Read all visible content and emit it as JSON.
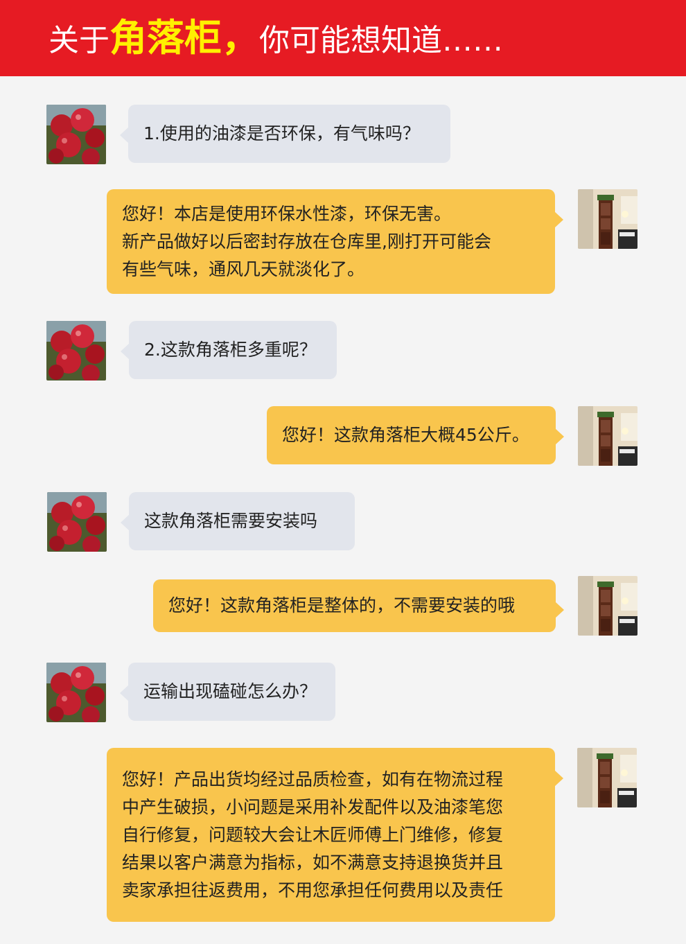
{
  "header": {
    "title_prefix": "关于",
    "title_highlight": "角落柜，",
    "title_suffix": "你可能想知道……"
  },
  "avatars": {
    "customer": "apple-photo",
    "seller": "corner-cabinet-photo"
  },
  "messages": [
    {
      "role": "customer",
      "lines": [
        "1.使用的油漆是否环保，有气味吗？"
      ]
    },
    {
      "role": "seller",
      "lines": [
        "您好！本店是使用环保水性漆，环保无害。",
        "新产品做好以后密封存放在仓库里,刚打开可能会",
        "有些气味，通风几天就淡化了。"
      ]
    },
    {
      "role": "customer",
      "lines": [
        "2.这款角落柜多重呢？"
      ]
    },
    {
      "role": "seller",
      "lines": [
        "您好！这款角落柜大概45公斤。"
      ]
    },
    {
      "role": "customer",
      "lines": [
        "这款角落柜需要安装吗"
      ]
    },
    {
      "role": "seller",
      "lines": [
        "您好！这款角落柜是整体的，不需要安装的哦"
      ]
    },
    {
      "role": "customer",
      "lines": [
        "运输出现磕碰怎么办？"
      ]
    },
    {
      "role": "seller",
      "lines": [
        "您好！产品出货均经过品质检查，如有在物流过程",
        "中产生破损，小问题是采用补发配件以及油漆笔您",
        "自行修复，问题较大会让木匠师傅上门维修，修复",
        "结果以客户满意为指标，如不满意支持退换货并且",
        "卖家承担往返费用，不用您承担任何费用以及责任"
      ]
    }
  ],
  "colors": {
    "header_bg": "#e61b23",
    "highlight": "#fff000",
    "question_bubble": "#e2e5ec",
    "answer_bubble": "#f9c54d"
  }
}
